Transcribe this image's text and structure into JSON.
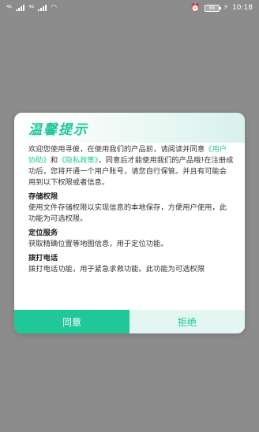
{
  "status_bar": {
    "network_small": "4G",
    "network_small_2": "4G",
    "wifi_icon": "wifi-icon",
    "alarm_icon": "alarm-icon",
    "battery": "88",
    "charge": "⚡",
    "time": "10:18"
  },
  "dialog": {
    "title": "温馨提示",
    "intro": {
      "part1": "欢迎您使用寻彼，在使用我们的产品前，请阅读并同意",
      "link1": "《用户协助》",
      "and": "和",
      "link2": "《隐私政策》",
      "part2": "，同意后才能使用我们的产品哦!在注册成功后，您将开通一个用户账号，请您自行保管。并且有可能会用到以下权限或者信息。"
    },
    "sections": [
      {
        "title": "存储权限",
        "text": "使用文件存储权限以实现信息的本地保存，方便用户使用，此功能为可选权限。"
      },
      {
        "title": "定位服务",
        "text": "获取精确位置等地图信息，用于定位功能。"
      },
      {
        "title": "拨打电话",
        "text": "拨打电话功能，用于紧急求救功能。此功能为可选权限"
      }
    ],
    "agree_label": "同意",
    "refuse_label": "拒绝"
  },
  "colors": {
    "accent": "#20c799",
    "overlay": "#8c8c8c",
    "refuse_bg": "#e3f6f1"
  }
}
